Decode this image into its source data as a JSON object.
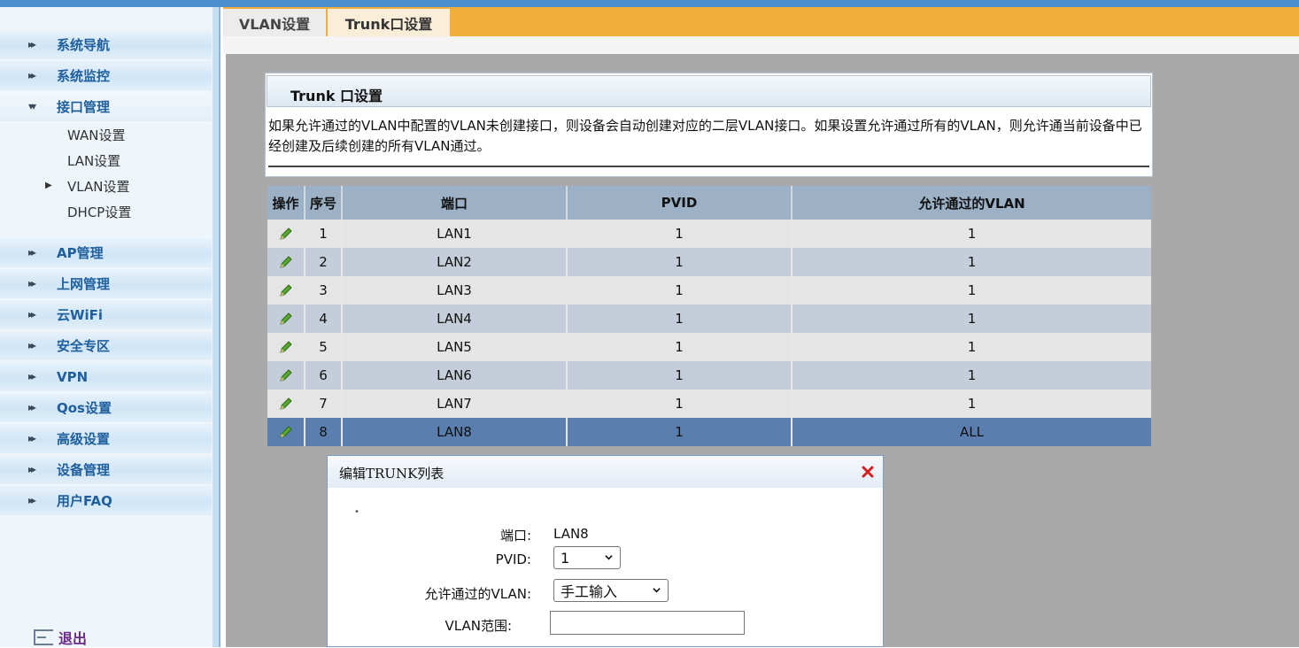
{
  "tabs": [
    {
      "label": "VLAN设置"
    },
    {
      "label": "Trunk口设置"
    }
  ],
  "sidebar": {
    "items": [
      {
        "label": "系统导航"
      },
      {
        "label": "系统监控"
      },
      {
        "label": "接口管理"
      },
      {
        "label": "AP管理"
      },
      {
        "label": "上网管理"
      },
      {
        "label": "云WiFi"
      },
      {
        "label": "安全专区"
      },
      {
        "label": "VPN"
      },
      {
        "label": "Qos设置"
      },
      {
        "label": "高级设置"
      },
      {
        "label": "设备管理"
      },
      {
        "label": "用户FAQ"
      }
    ],
    "subitems": [
      {
        "label": "WAN设置"
      },
      {
        "label": "LAN设置"
      },
      {
        "label": "VLAN设置"
      },
      {
        "label": "DHCP设置"
      }
    ],
    "logout_label": "退出"
  },
  "panel": {
    "title": "Trunk 口设置",
    "description": "如果允许通过的VLAN中配置的VLAN未创建接口，则设备会自动创建对应的二层VLAN接口。如果设置允许通过所有的VLAN，则允许通当前设备中已经创建及后续创建的所有VLAN通过。"
  },
  "table": {
    "headers": [
      "操作",
      "序号",
      "端口",
      "PVID",
      "允许通过的VLAN"
    ],
    "rows": [
      {
        "index": "1",
        "port": "LAN1",
        "pvid": "1",
        "vlan": "1"
      },
      {
        "index": "2",
        "port": "LAN2",
        "pvid": "1",
        "vlan": "1"
      },
      {
        "index": "3",
        "port": "LAN3",
        "pvid": "1",
        "vlan": "1"
      },
      {
        "index": "4",
        "port": "LAN4",
        "pvid": "1",
        "vlan": "1"
      },
      {
        "index": "5",
        "port": "LAN5",
        "pvid": "1",
        "vlan": "1"
      },
      {
        "index": "6",
        "port": "LAN6",
        "pvid": "1",
        "vlan": "1"
      },
      {
        "index": "7",
        "port": "LAN7",
        "pvid": "1",
        "vlan": "1"
      },
      {
        "index": "8",
        "port": "LAN8",
        "pvid": "1",
        "vlan": "ALL"
      }
    ]
  },
  "dialog": {
    "title": "编辑TRUNK列表",
    "port_label": "端口:",
    "port_value": "LAN8",
    "pvid_label": "PVID:",
    "pvid_value": "1",
    "vlan_label": "允许通过的VLAN:",
    "vlan_value": "手工输入",
    "range_label": "VLAN范围:",
    "range_value": ""
  },
  "colors": {
    "topbar": "#4a8fd0",
    "tabbar": "#f3ad3b",
    "selected_row": "#5a7eae",
    "table_header": "#9cb0c6",
    "sidebar_label": "#1f5f9e"
  }
}
